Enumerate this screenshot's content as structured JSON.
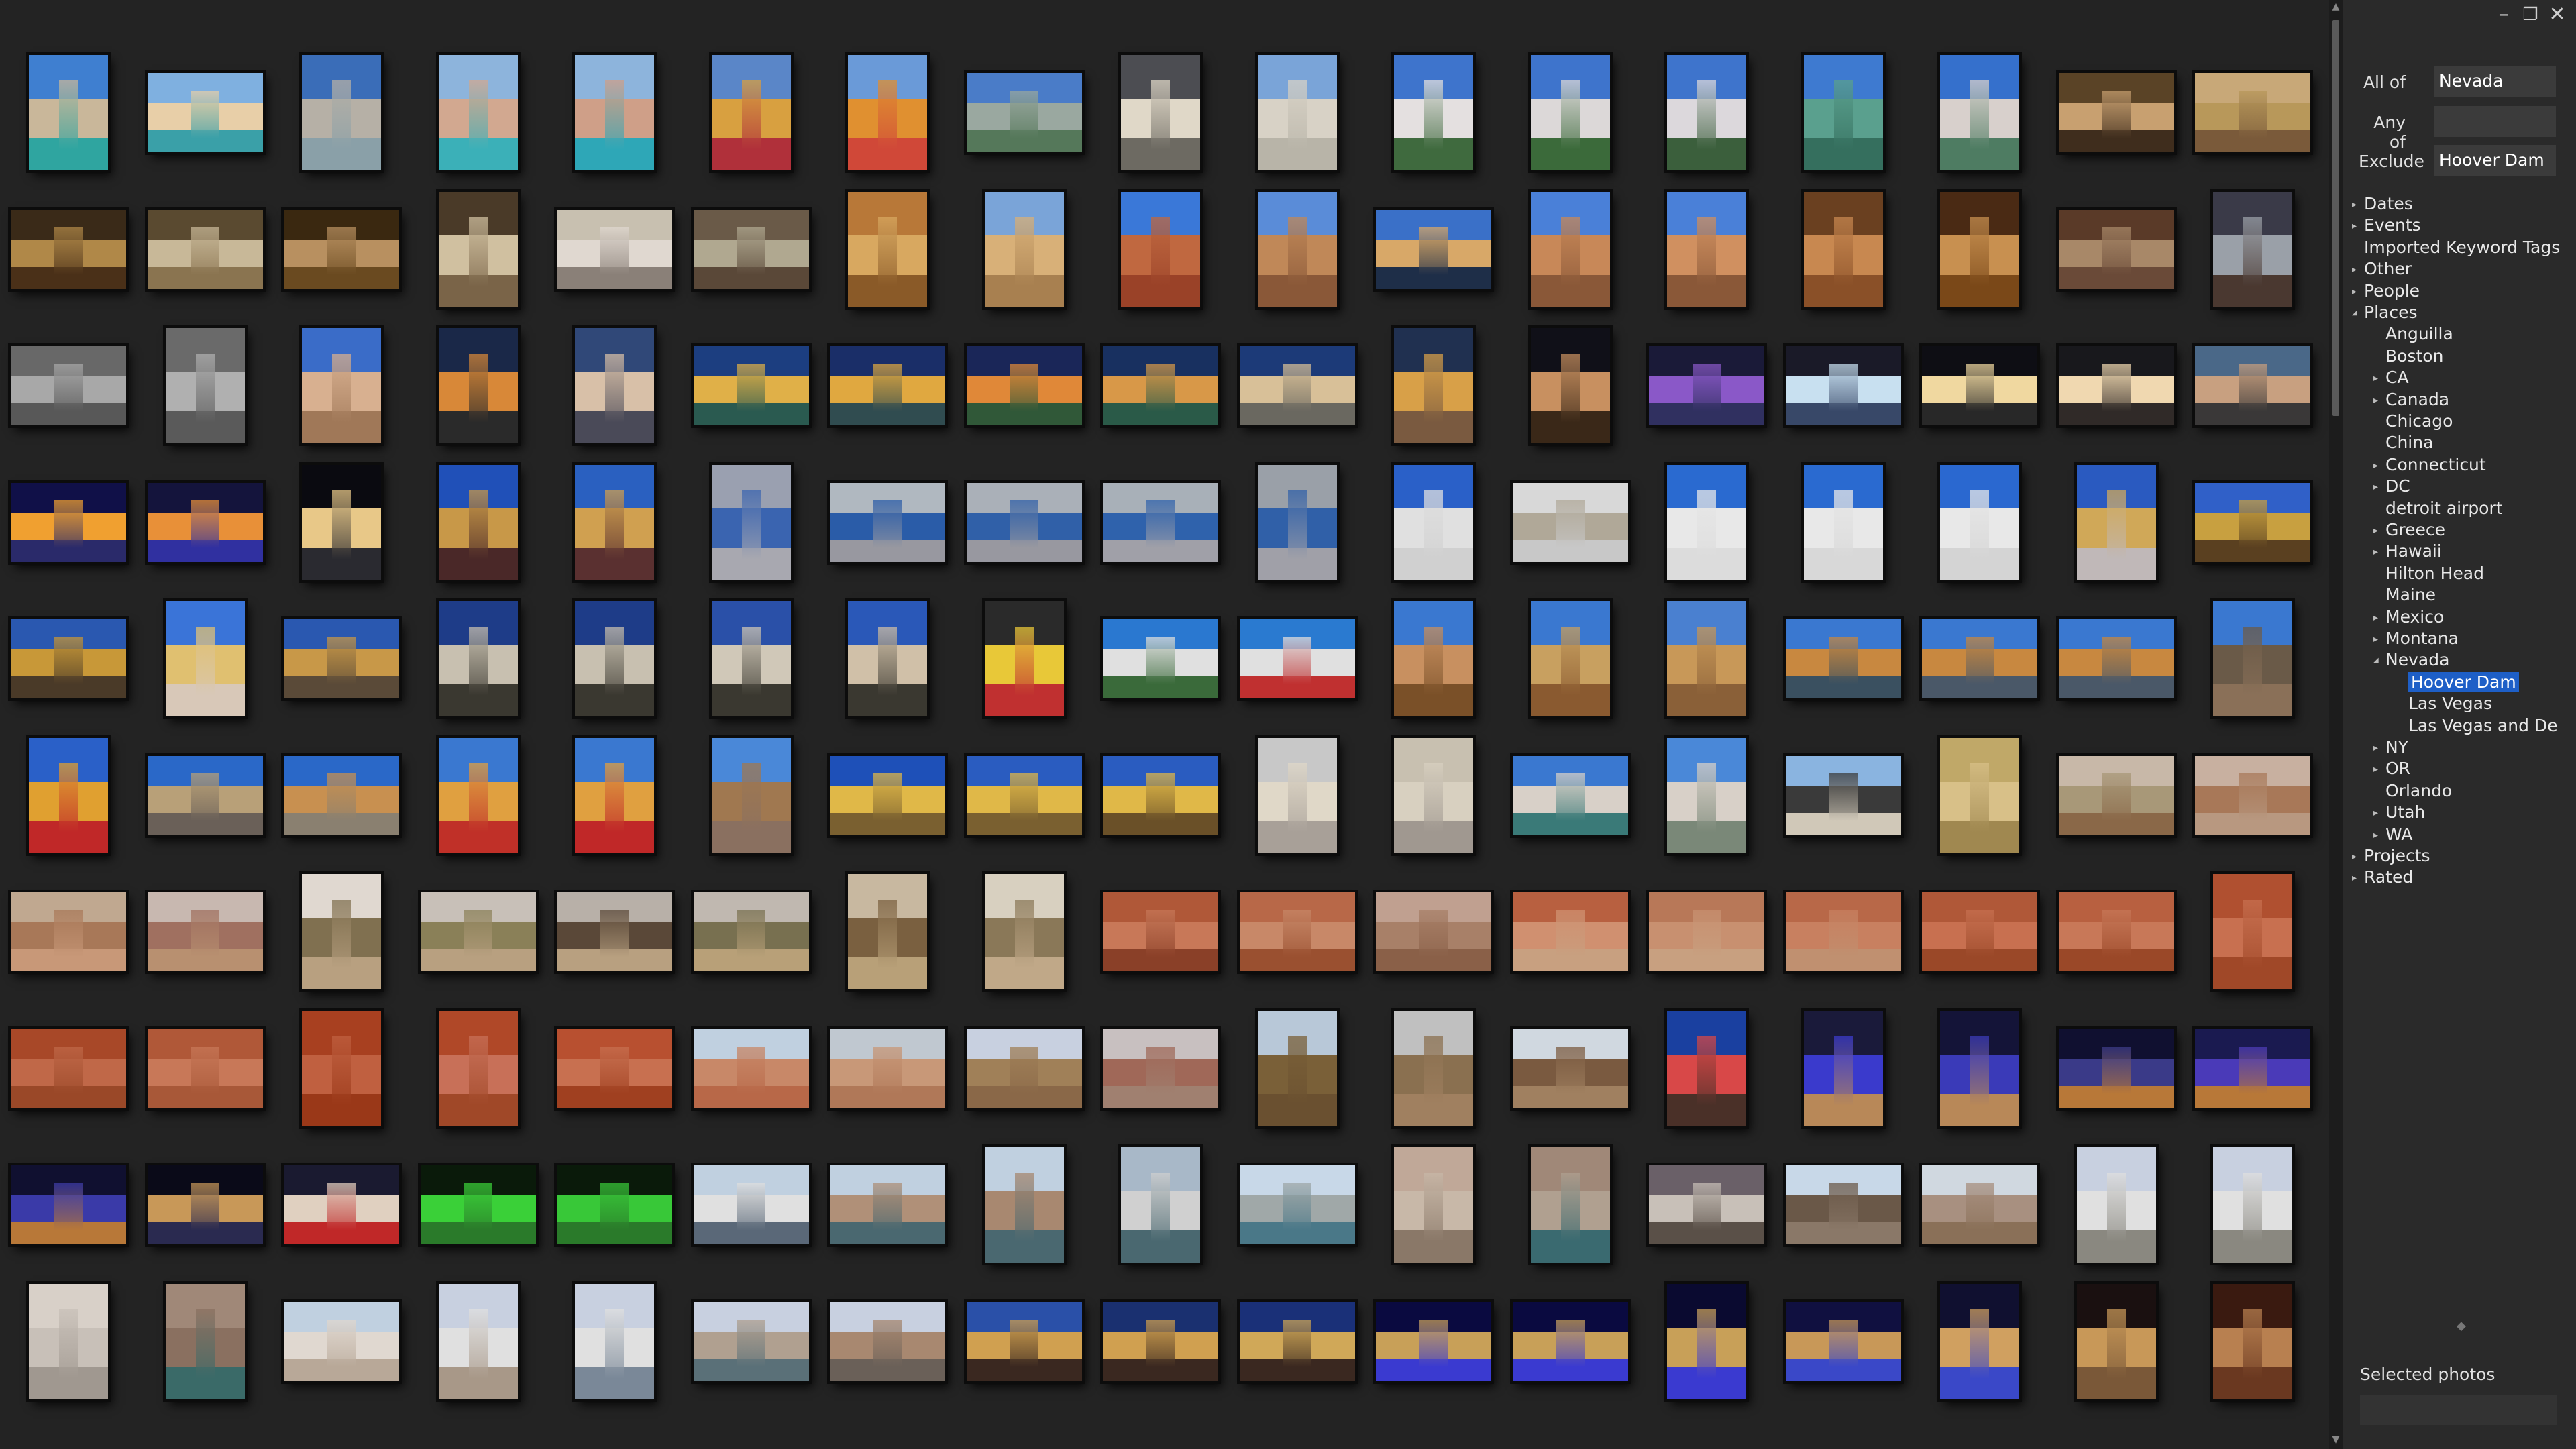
{
  "window_controls": {
    "minimize": "minimize-icon",
    "restore": "restore-icon",
    "close": "close-icon"
  },
  "filters": [
    {
      "label": "All of",
      "value": "Nevada"
    },
    {
      "label": "Any of",
      "value": ""
    },
    {
      "label": "Exclude",
      "value": "Hoover Dam"
    }
  ],
  "tree": [
    {
      "label": "Dates",
      "level": 0,
      "expand": "closed"
    },
    {
      "label": "Events",
      "level": 0,
      "expand": "closed"
    },
    {
      "label": "Imported Keyword Tags",
      "level": 0,
      "expand": "none"
    },
    {
      "label": "Other",
      "level": 0,
      "expand": "closed"
    },
    {
      "label": "People",
      "level": 0,
      "expand": "closed"
    },
    {
      "label": "Places",
      "level": 0,
      "expand": "open"
    },
    {
      "label": "Anguilla",
      "level": 1,
      "expand": "none"
    },
    {
      "label": "Boston",
      "level": 1,
      "expand": "none"
    },
    {
      "label": "CA",
      "level": 1,
      "expand": "closed"
    },
    {
      "label": "Canada",
      "level": 1,
      "expand": "closed"
    },
    {
      "label": "Chicago",
      "level": 1,
      "expand": "none"
    },
    {
      "label": "China",
      "level": 1,
      "expand": "none"
    },
    {
      "label": "Connecticut",
      "level": 1,
      "expand": "closed"
    },
    {
      "label": "DC",
      "level": 1,
      "expand": "closed"
    },
    {
      "label": "detroit airport",
      "level": 1,
      "expand": "none"
    },
    {
      "label": "Greece",
      "level": 1,
      "expand": "closed"
    },
    {
      "label": "Hawaii",
      "level": 1,
      "expand": "closed"
    },
    {
      "label": "Hilton Head",
      "level": 1,
      "expand": "none"
    },
    {
      "label": "Maine",
      "level": 1,
      "expand": "none"
    },
    {
      "label": "Mexico",
      "level": 1,
      "expand": "closed"
    },
    {
      "label": "Montana",
      "level": 1,
      "expand": "closed"
    },
    {
      "label": "Nevada",
      "level": 1,
      "expand": "open"
    },
    {
      "label": "Hoover Dam",
      "level": 2,
      "expand": "none",
      "selected": true
    },
    {
      "label": "Las Vegas",
      "level": 2,
      "expand": "none"
    },
    {
      "label": "Las Vegas and De",
      "level": 2,
      "expand": "none"
    },
    {
      "label": "NY",
      "level": 1,
      "expand": "closed"
    },
    {
      "label": "OR",
      "level": 1,
      "expand": "closed"
    },
    {
      "label": "Orlando",
      "level": 1,
      "expand": "none"
    },
    {
      "label": "Utah",
      "level": 1,
      "expand": "closed"
    },
    {
      "label": "WA",
      "level": 1,
      "expand": "closed"
    },
    {
      "label": "Projects",
      "level": 0,
      "expand": "closed"
    },
    {
      "label": "Rated",
      "level": 0,
      "expand": "closed"
    }
  ],
  "selected_photos_label": "Selected photos",
  "photo_rows": [
    [
      [
        "p",
        "#3f7fd0",
        "#c9b79a",
        "#2fa5a0"
      ],
      [
        "l",
        "#7fb0e0",
        "#e8cfa8",
        "#3aa0a8"
      ],
      [
        "p",
        "#3a6db8",
        "#b6b0a6",
        "#8aa0a8"
      ],
      [
        "p",
        "#8db4dc",
        "#d2a890",
        "#3bb0b8"
      ],
      [
        "p",
        "#8db4dc",
        "#cf9f88",
        "#2ea7b7"
      ],
      [
        "p",
        "#5a86c8",
        "#d8a040",
        "#b0303a"
      ],
      [
        "p",
        "#6a9ad8",
        "#e09030",
        "#d04838"
      ],
      [
        "l",
        "#4a7cc8",
        "#9aa8a0",
        "#55785a"
      ],
      [
        "p",
        "#4c4d52",
        "#e0d8c8",
        "#6d6a62"
      ],
      [
        "p",
        "#7aa4d8",
        "#d8d2c6",
        "#b8b4a8"
      ],
      [
        "p",
        "#3e74cc",
        "#e4e0e0",
        "#3f6a3e"
      ],
      [
        "p",
        "#3e74cc",
        "#dcd8d8",
        "#3b6a3a"
      ],
      [
        "p",
        "#3e74cc",
        "#dcd8dc",
        "#3b5f3c"
      ],
      [
        "p",
        "#3e7ad0",
        "#5aa08e",
        "#356f5e"
      ],
      [
        "p",
        "#3570cc",
        "#d8d0cc",
        "#4e7c62"
      ],
      [
        "l",
        "#5a4326",
        "#c8a070",
        "#3f2d1d"
      ],
      [
        "l",
        "#c8a878",
        "#b8985a",
        "#7a5a3a"
      ]
    ],
    [
      [
        "l",
        "#3a2a18",
        "#b08848",
        "#4a3018"
      ],
      [
        "l",
        "#5a4a30",
        "#c8b898",
        "#8a7450"
      ],
      [
        "l",
        "#3a2810",
        "#b89060",
        "#6a4a20"
      ],
      [
        "p",
        "#4a3a28",
        "#d0c0a0",
        "#7a6448"
      ],
      [
        "l",
        "#c8c0b0",
        "#e0d8d0",
        "#8a8078"
      ],
      [
        "l",
        "#6a5a48",
        "#b0a890",
        "#5a4838"
      ],
      [
        "p",
        "#b87838",
        "#d8a860",
        "#8a5a28"
      ],
      [
        "p",
        "#7aa4d8",
        "#d8b078",
        "#a88050"
      ],
      [
        "p",
        "#3a78d8",
        "#c06840",
        "#9a4228"
      ],
      [
        "p",
        "#5a8cd8",
        "#c08858",
        "#8a5838"
      ],
      [
        "l",
        "#3a70c8",
        "#d8a868",
        "#1e2e48"
      ],
      [
        "p",
        "#4a80d8",
        "#c88858",
        "#8a5838"
      ],
      [
        "p",
        "#4a80d8",
        "#d09060",
        "#8a5838"
      ],
      [
        "p",
        "#6a4020",
        "#c88850",
        "#8a5028"
      ],
      [
        "p",
        "#4a2a14",
        "#c89050",
        "#7a4818"
      ],
      [
        "l",
        "#5a3a28",
        "#a88868",
        "#6a4a38"
      ],
      [
        "p",
        "#3a3a48",
        "#9aa0a8",
        "#4a3830"
      ]
    ],
    [
      [
        "l",
        "#686868",
        "#a8a8a8",
        "#585858"
      ],
      [
        "p",
        "#6a6a6a",
        "#b0b0b0",
        "#5a5a5a"
      ],
      [
        "p",
        "#3a6cc8",
        "#d8b090",
        "#a07858"
      ],
      [
        "p",
        "#1a2848",
        "#d88838",
        "#2a2a2a"
      ],
      [
        "p",
        "#304878",
        "#d8c0a8",
        "#4a4a58"
      ],
      [
        "l",
        "#1c3e80",
        "#e0b048",
        "#2a5a50"
      ],
      [
        "l",
        "#1a2e68",
        "#e0a840",
        "#304c50"
      ],
      [
        "l",
        "#1a2658",
        "#e08838",
        "#305838"
      ],
      [
        "l",
        "#183060",
        "#d89848",
        "#2a5a48"
      ],
      [
        "l",
        "#1c3a78",
        "#d8c098",
        "#6a6860"
      ],
      [
        "p",
        "#203050",
        "#d8a048",
        "#7a5a40"
      ],
      [
        "p",
        "#101018",
        "#c89060",
        "#3a2818"
      ],
      [
        "l",
        "#1a1a38",
        "#8a58c8",
        "#303060"
      ],
      [
        "l",
        "#1a1a28",
        "#c8e0f0",
        "#384868"
      ],
      [
        "l",
        "#0e0e14",
        "#f0d8a0",
        "#282828"
      ],
      [
        "l",
        "#18181c",
        "#f0d8b0",
        "#302a28"
      ],
      [
        "l",
        "#4a6888",
        "#c8a080",
        "#3a3838"
      ]
    ],
    [
      [
        "l",
        "#101048",
        "#f0a030",
        "#2a2a6a"
      ],
      [
        "l",
        "#14143c",
        "#e89038",
        "#3030a0"
      ],
      [
        "p",
        "#0a0a10",
        "#e8c888",
        "#2a2a30"
      ],
      [
        "p",
        "#2050b8",
        "#c89848",
        "#4a2828"
      ],
      [
        "p",
        "#2a60c0",
        "#d0a050",
        "#5a3030"
      ],
      [
        "p",
        "#9aa0b0",
        "#3a64b0",
        "#a8a8b0"
      ],
      [
        "l",
        "#b0b8c0",
        "#2a5ca8",
        "#9898a0"
      ],
      [
        "l",
        "#aab0b8",
        "#3060a8",
        "#9898a0"
      ],
      [
        "l",
        "#a8b0b8",
        "#2f62ac",
        "#a0a0a8"
      ],
      [
        "p",
        "#9aa0a8",
        "#3060a8",
        "#a0a0a8"
      ],
      [
        "p",
        "#2a60c8",
        "#e0e0e0",
        "#d0d0d0"
      ],
      [
        "l",
        "#d8d8d8",
        "#b0a898",
        "#c8c8c8"
      ],
      [
        "p",
        "#2a6ad0",
        "#e8e8e8",
        "#dcdcdc"
      ],
      [
        "p",
        "#2a6ad0",
        "#e8e8e8",
        "#d8d8d8"
      ],
      [
        "p",
        "#2a68d0",
        "#e8e8e8",
        "#d4d4d4"
      ],
      [
        "p",
        "#2a5ac0",
        "#d0a858",
        "#c0b8b8"
      ],
      [
        "l",
        "#3060c8",
        "#c8a040",
        "#5a4020"
      ]
    ],
    [
      [
        "l",
        "#2a58b0",
        "#c89838",
        "#4a3a28"
      ],
      [
        "p",
        "#3a74d8",
        "#e0c070",
        "#d8c8b8"
      ],
      [
        "l",
        "#2a58b0",
        "#c89848",
        "#5a4a38"
      ],
      [
        "p",
        "#1e3c88",
        "#c8c0b0",
        "#3a3830"
      ],
      [
        "p",
        "#1e3c88",
        "#c8c0b0",
        "#3a3830"
      ],
      [
        "p",
        "#2a50a8",
        "#d0c8b8",
        "#3a3830"
      ],
      [
        "p",
        "#2a58b8",
        "#d0c0a8",
        "#3a3830"
      ],
      [
        "p",
        "#2a2a2a",
        "#e8c838",
        "#c03030"
      ],
      [
        "l",
        "#2a78d0",
        "#e0e0e0",
        "#3a6a3a"
      ],
      [
        "l",
        "#2a7ad0",
        "#e0e0e0",
        "#c03030"
      ],
      [
        "p",
        "#3a78d0",
        "#c89060",
        "#7a5028"
      ],
      [
        "p",
        "#3a78d0",
        "#c8a060",
        "#8a5a30"
      ],
      [
        "p",
        "#4a80d0",
        "#c89858",
        "#8a6038"
      ],
      [
        "l",
        "#3a78d0",
        "#c88840",
        "#3a5060"
      ],
      [
        "l",
        "#3a78d0",
        "#c88840",
        "#4a5868"
      ],
      [
        "l",
        "#3a78d0",
        "#c88840",
        "#4a5868"
      ],
      [
        "p",
        "#3a78d0",
        "#6a5a48",
        "#8a7058"
      ]
    ],
    [
      [
        "p",
        "#2a60c8",
        "#e0a030",
        "#c02828"
      ],
      [
        "l",
        "#2a68c8",
        "#b8a078",
        "#6a6058"
      ],
      [
        "l",
        "#2a68c8",
        "#c89050",
        "#8a8070"
      ],
      [
        "p",
        "#3a78d0",
        "#e0a040",
        "#c03028"
      ],
      [
        "p",
        "#3a78d0",
        "#e0a040",
        "#c02828"
      ],
      [
        "p",
        "#4a88d8",
        "#a07850",
        "#8a7060"
      ],
      [
        "l",
        "#1e50b8",
        "#e0b848",
        "#7a6030"
      ],
      [
        "l",
        "#2a5cc0",
        "#e0b848",
        "#7a6030"
      ],
      [
        "l",
        "#2a5cc0",
        "#e0b848",
        "#6a5028"
      ],
      [
        "p",
        "#c8c8c8",
        "#e0d8c8",
        "#a8a098"
      ],
      [
        "p",
        "#c8c0b0",
        "#d8d0c0",
        "#a09890"
      ],
      [
        "l",
        "#3a78d0",
        "#d8d0c8",
        "#3a7a78"
      ],
      [
        "p",
        "#4a88d8",
        "#d8d0c8",
        "#7a8878"
      ],
      [
        "l",
        "#8ab4e0",
        "#3a3a3a",
        "#d0c8b8"
      ],
      [
        "p",
        "#c0a868",
        "#d8c088",
        "#a08850"
      ],
      [
        "l",
        "#c8b8a8",
        "#a89878",
        "#8a6848"
      ],
      [
        "l",
        "#c8b0a0",
        "#a87858",
        "#b89880"
      ]
    ],
    [
      [
        "l",
        "#c0a890",
        "#a87858",
        "#c89878"
      ],
      [
        "l",
        "#c8b8b0",
        "#a07060",
        "#b89070"
      ],
      [
        "p",
        "#e0d8d0",
        "#807050",
        "#b8a080"
      ],
      [
        "l",
        "#c8c0b8",
        "#8a8058",
        "#b8a080"
      ],
      [
        "l",
        "#b8b0a8",
        "#5a4838",
        "#b8a080"
      ],
      [
        "l",
        "#c0b8b0",
        "#787050",
        "#b8a078"
      ],
      [
        "p",
        "#c8b8a0",
        "#7a6040",
        "#b8a078"
      ],
      [
        "p",
        "#d8d0c0",
        "#8a7858",
        "#c0a888"
      ],
      [
        "l",
        "#b05838",
        "#c87858",
        "#8a4028"
      ],
      [
        "l",
        "#b86848",
        "#c88868",
        "#9a5030"
      ],
      [
        "l",
        "#c0a090",
        "#a88068",
        "#8a6048"
      ],
      [
        "l",
        "#b86040",
        "#d09070",
        "#c8a080"
      ],
      [
        "l",
        "#b87858",
        "#c89070",
        "#c8a080"
      ],
      [
        "l",
        "#b86848",
        "#c88060",
        "#c09070"
      ],
      [
        "l",
        "#b05838",
        "#c87050",
        "#9a4828"
      ],
      [
        "l",
        "#b86040",
        "#c87858",
        "#9a4828"
      ],
      [
        "p",
        "#b05030",
        "#c87050",
        "#a04828"
      ]
    ],
    [
      [
        "l",
        "#a84828",
        "#c06848",
        "#9a4828"
      ],
      [
        "l",
        "#b05838",
        "#c87858",
        "#a85838"
      ],
      [
        "p",
        "#a84020",
        "#c06040",
        "#9a3818"
      ],
      [
        "p",
        "#b04828",
        "#c87058",
        "#a04828"
      ],
      [
        "l",
        "#b85030",
        "#c87050",
        "#a04020"
      ],
      [
        "l",
        "#c0d0e0",
        "#c88868",
        "#b86848"
      ],
      [
        "l",
        "#c0c8d0",
        "#c89878",
        "#b07858"
      ],
      [
        "l",
        "#c8d0e0",
        "#a08058",
        "#8a6848"
      ],
      [
        "l",
        "#c8c0c0",
        "#a06858",
        "#a08070"
      ],
      [
        "p",
        "#b8c8d8",
        "#7a6038",
        "#6a5030"
      ],
      [
        "p",
        "#c0c0c0",
        "#8a7050",
        "#a08060"
      ],
      [
        "l",
        "#d0d8e0",
        "#7a5a40",
        "#a08060"
      ],
      [
        "p",
        "#1a40a0",
        "#d84848",
        "#4a3028"
      ],
      [
        "p",
        "#1a1a3a",
        "#3a3acc",
        "#b88858"
      ],
      [
        "p",
        "#141438",
        "#3a3ab8",
        "#b88858"
      ],
      [
        "l",
        "#101030",
        "#3a3a88",
        "#b87838"
      ],
      [
        "l",
        "#1a1a50",
        "#4a3ab8",
        "#b87838"
      ]
    ],
    [
      [
        "l",
        "#101030",
        "#3a3aa8",
        "#b87838"
      ],
      [
        "l",
        "#0a0a18",
        "#c89858",
        "#2a2a50"
      ],
      [
        "l",
        "#1a1a30",
        "#e0d0c0",
        "#c02828"
      ],
      [
        "l",
        "#0a1a0a",
        "#3ad038",
        "#2a7a2a"
      ],
      [
        "l",
        "#0a1a0a",
        "#38c838",
        "#2a7a2a"
      ],
      [
        "l",
        "#c0d0e0",
        "#e0e0e0",
        "#5a6878"
      ],
      [
        "l",
        "#c0d0e0",
        "#b09078",
        "#4a6870"
      ],
      [
        "p",
        "#c0d0e0",
        "#a88870",
        "#4a6870"
      ],
      [
        "p",
        "#a8b8c8",
        "#d0d0d0",
        "#4a6870"
      ],
      [
        "l",
        "#c8d8e8",
        "#a0a8a8",
        "#4a7888"
      ],
      [
        "p",
        "#c0a898",
        "#c8b8a8",
        "#8a7868"
      ],
      [
        "p",
        "#a08878",
        "#b0a090",
        "#3a6a70"
      ],
      [
        "l",
        "#6a6068",
        "#c8c0b8",
        "#5a5048"
      ],
      [
        "l",
        "#c8d8e8",
        "#6a5848",
        "#8a7868"
      ],
      [
        "l",
        "#d0d8e0",
        "#a89080",
        "#8a7058"
      ],
      [
        "p",
        "#c8d0e0",
        "#e0e0e0",
        "#8a8880"
      ],
      [
        "p",
        "#c8d0e0",
        "#e0e0e0",
        "#8a8880"
      ]
    ],
    [
      [
        "p",
        "#d8d0c8",
        "#c8c0b8",
        "#a09890"
      ],
      [
        "p",
        "#a08878",
        "#8a7060",
        "#3a6a68"
      ],
      [
        "l",
        "#c0d0e0",
        "#e0d8d0",
        "#b8a898"
      ],
      [
        "p",
        "#c8d0e0",
        "#e0e0e0",
        "#a89888"
      ],
      [
        "p",
        "#c8d0e0",
        "#e0e0e0",
        "#7a8898"
      ],
      [
        "l",
        "#c8d0e0",
        "#b0a090",
        "#5a7078"
      ],
      [
        "l",
        "#c8d0e0",
        "#a88870",
        "#6a6058"
      ],
      [
        "l",
        "#2a50a8",
        "#d0a050",
        "#3a2820"
      ],
      [
        "l",
        "#1a3070",
        "#d0a050",
        "#3a2820"
      ],
      [
        "l",
        "#1a3078",
        "#d0a858",
        "#3a2820"
      ],
      [
        "l",
        "#0a0a40",
        "#c8a058",
        "#3a3ad0"
      ],
      [
        "l",
        "#0a0a40",
        "#c8a058",
        "#3a3ad0"
      ],
      [
        "p",
        "#0a0a30",
        "#c8a058",
        "#3a3ad0"
      ],
      [
        "l",
        "#101040",
        "#c89858",
        "#3a48c8"
      ],
      [
        "p",
        "#101030",
        "#d0a060",
        "#3a48c8"
      ],
      [
        "p",
        "#1a1010",
        "#c89858",
        "#7a5838"
      ],
      [
        "p",
        "#3a1a10",
        "#b88050",
        "#6a3820"
      ]
    ]
  ]
}
